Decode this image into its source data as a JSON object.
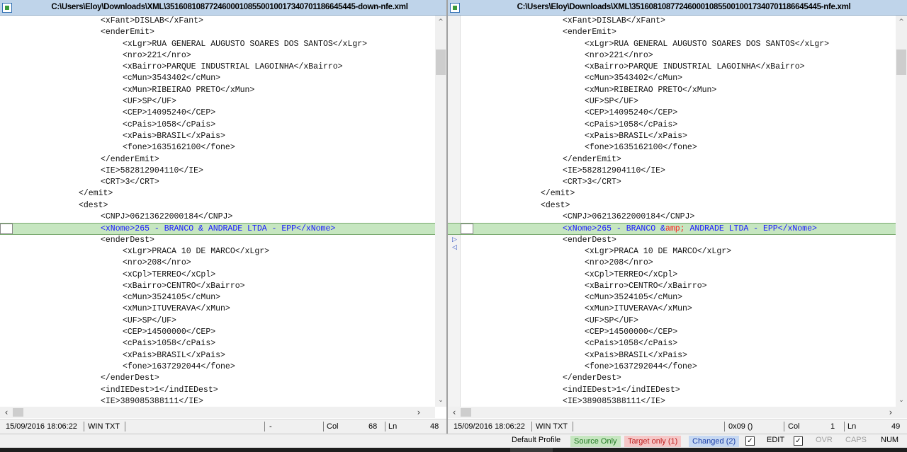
{
  "left": {
    "title": "C:\\Users\\Eloy\\Downloads\\XML\\35160810877246000108550010017340701186645445-down-nfe.xml",
    "lines": [
      {
        "indent": 4,
        "text": "<xFant>DISLAB</xFant>"
      },
      {
        "indent": 4,
        "text": "<enderEmit>"
      },
      {
        "indent": 5,
        "text": "<xLgr>RUA GENERAL AUGUSTO SOARES DOS SANTOS</xLgr>"
      },
      {
        "indent": 5,
        "text": "<nro>221</nro>"
      },
      {
        "indent": 5,
        "text": "<xBairro>PARQUE INDUSTRIAL LAGOINHA</xBairro>"
      },
      {
        "indent": 5,
        "text": "<cMun>3543402</cMun>"
      },
      {
        "indent": 5,
        "text": "<xMun>RIBEIRAO PRETO</xMun>"
      },
      {
        "indent": 5,
        "text": "<UF>SP</UF>"
      },
      {
        "indent": 5,
        "text": "<CEP>14095240</CEP>"
      },
      {
        "indent": 5,
        "text": "<cPais>1058</cPais>"
      },
      {
        "indent": 5,
        "text": "<xPais>BRASIL</xPais>"
      },
      {
        "indent": 5,
        "text": "<fone>1635162100</fone>"
      },
      {
        "indent": 4,
        "text": "</enderEmit>"
      },
      {
        "indent": 4,
        "text": "<IE>582812904110</IE>"
      },
      {
        "indent": 4,
        "text": "<CRT>3</CRT>"
      },
      {
        "indent": 3,
        "text": "</emit>"
      },
      {
        "indent": 3,
        "text": "<dest>"
      },
      {
        "indent": 4,
        "text": "<CNPJ>06213622000184</CNPJ>"
      },
      {
        "indent": 4,
        "text": "<xNome>265 - BRANCO & ANDRADE LTDA - EPP</xNome>",
        "changed": true
      },
      {
        "indent": 4,
        "text": "<enderDest>"
      },
      {
        "indent": 5,
        "text": "<xLgr>PRACA 10 DE MARCO</xLgr>"
      },
      {
        "indent": 5,
        "text": "<nro>208</nro>"
      },
      {
        "indent": 5,
        "text": "<xCpl>TERREO</xCpl>"
      },
      {
        "indent": 5,
        "text": "<xBairro>CENTRO</xBairro>"
      },
      {
        "indent": 5,
        "text": "<cMun>3524105</cMun>"
      },
      {
        "indent": 5,
        "text": "<xMun>ITUVERAVA</xMun>"
      },
      {
        "indent": 5,
        "text": "<UF>SP</UF>"
      },
      {
        "indent": 5,
        "text": "<CEP>14500000</CEP>"
      },
      {
        "indent": 5,
        "text": "<cPais>1058</cPais>"
      },
      {
        "indent": 5,
        "text": "<xPais>BRASIL</xPais>"
      },
      {
        "indent": 5,
        "text": "<fone>1637292044</fone>"
      },
      {
        "indent": 4,
        "text": "</enderDest>"
      },
      {
        "indent": 4,
        "text": "<indIEDest>1</indIEDest>"
      },
      {
        "indent": 4,
        "text": "<IE>389085388111</IE>"
      }
    ],
    "status": {
      "datetime": "15/09/2016 18:06:22",
      "format": "WIN TXT",
      "char": "-",
      "col_label": "Col",
      "col": "68",
      "ln_label": "Ln",
      "ln": "48"
    }
  },
  "right": {
    "title": "C:\\Users\\Eloy\\Downloads\\XML\\35160810877246000108550010017340701186645445-nfe.xml",
    "lines": [
      {
        "indent": 4,
        "text": "<xFant>DISLAB</xFant>"
      },
      {
        "indent": 4,
        "text": "<enderEmit>"
      },
      {
        "indent": 5,
        "text": "<xLgr>RUA GENERAL AUGUSTO SOARES DOS SANTOS</xLgr>"
      },
      {
        "indent": 5,
        "text": "<nro>221</nro>"
      },
      {
        "indent": 5,
        "text": "<xBairro>PARQUE INDUSTRIAL LAGOINHA</xBairro>"
      },
      {
        "indent": 5,
        "text": "<cMun>3543402</cMun>"
      },
      {
        "indent": 5,
        "text": "<xMun>RIBEIRAO PRETO</xMun>"
      },
      {
        "indent": 5,
        "text": "<UF>SP</UF>"
      },
      {
        "indent": 5,
        "text": "<CEP>14095240</CEP>"
      },
      {
        "indent": 5,
        "text": "<cPais>1058</cPais>"
      },
      {
        "indent": 5,
        "text": "<xPais>BRASIL</xPais>"
      },
      {
        "indent": 5,
        "text": "<fone>1635162100</fone>"
      },
      {
        "indent": 4,
        "text": "</enderEmit>"
      },
      {
        "indent": 4,
        "text": "<IE>582812904110</IE>"
      },
      {
        "indent": 4,
        "text": "<CRT>3</CRT>"
      },
      {
        "indent": 3,
        "text": "</emit>"
      },
      {
        "indent": 3,
        "text": "<dest>"
      },
      {
        "indent": 4,
        "text": "<CNPJ>06213622000184</CNPJ>"
      },
      {
        "indent": 4,
        "text": "<xNome>265 - BRANCO &amp; ANDRADE LTDA - EPP</xNome>",
        "changed": true,
        "highlight": "amp;"
      },
      {
        "indent": 4,
        "text": "<enderDest>"
      },
      {
        "indent": 5,
        "text": "<xLgr>PRACA 10 DE MARCO</xLgr>"
      },
      {
        "indent": 5,
        "text": "<nro>208</nro>"
      },
      {
        "indent": 5,
        "text": "<xCpl>TERREO</xCpl>"
      },
      {
        "indent": 5,
        "text": "<xBairro>CENTRO</xBairro>"
      },
      {
        "indent": 5,
        "text": "<cMun>3524105</cMun>"
      },
      {
        "indent": 5,
        "text": "<xMun>ITUVERAVA</xMun>"
      },
      {
        "indent": 5,
        "text": "<UF>SP</UF>"
      },
      {
        "indent": 5,
        "text": "<CEP>14500000</CEP>"
      },
      {
        "indent": 5,
        "text": "<cPais>1058</cPais>"
      },
      {
        "indent": 5,
        "text": "<xPais>BRASIL</xPais>"
      },
      {
        "indent": 5,
        "text": "<fone>1637292044</fone>"
      },
      {
        "indent": 4,
        "text": "</enderDest>"
      },
      {
        "indent": 4,
        "text": "<indIEDest>1</indIEDest>"
      },
      {
        "indent": 4,
        "text": "<IE>389085388111</IE>"
      }
    ],
    "status": {
      "datetime": "15/09/2016 18:06:22",
      "format": "WIN TXT",
      "char": "0x09 ()",
      "col_label": "Col",
      "col": "1",
      "ln_label": "Ln",
      "ln": "49"
    }
  },
  "bottom": {
    "profile": "Default Profile",
    "source_only": "Source Only",
    "target_only": "Target only (1)",
    "changed": "Changed (2)",
    "edit": "EDIT",
    "ovr": "OVR",
    "caps": "CAPS",
    "num": "NUM",
    "edit_checked": true,
    "ovr_checked": true
  },
  "colors": {
    "changed_line_bg": "#c6e6c0",
    "changed_text": "#1a1aff",
    "diff_highlight": "#ff2020",
    "title_bg": "#bfd4ea"
  }
}
